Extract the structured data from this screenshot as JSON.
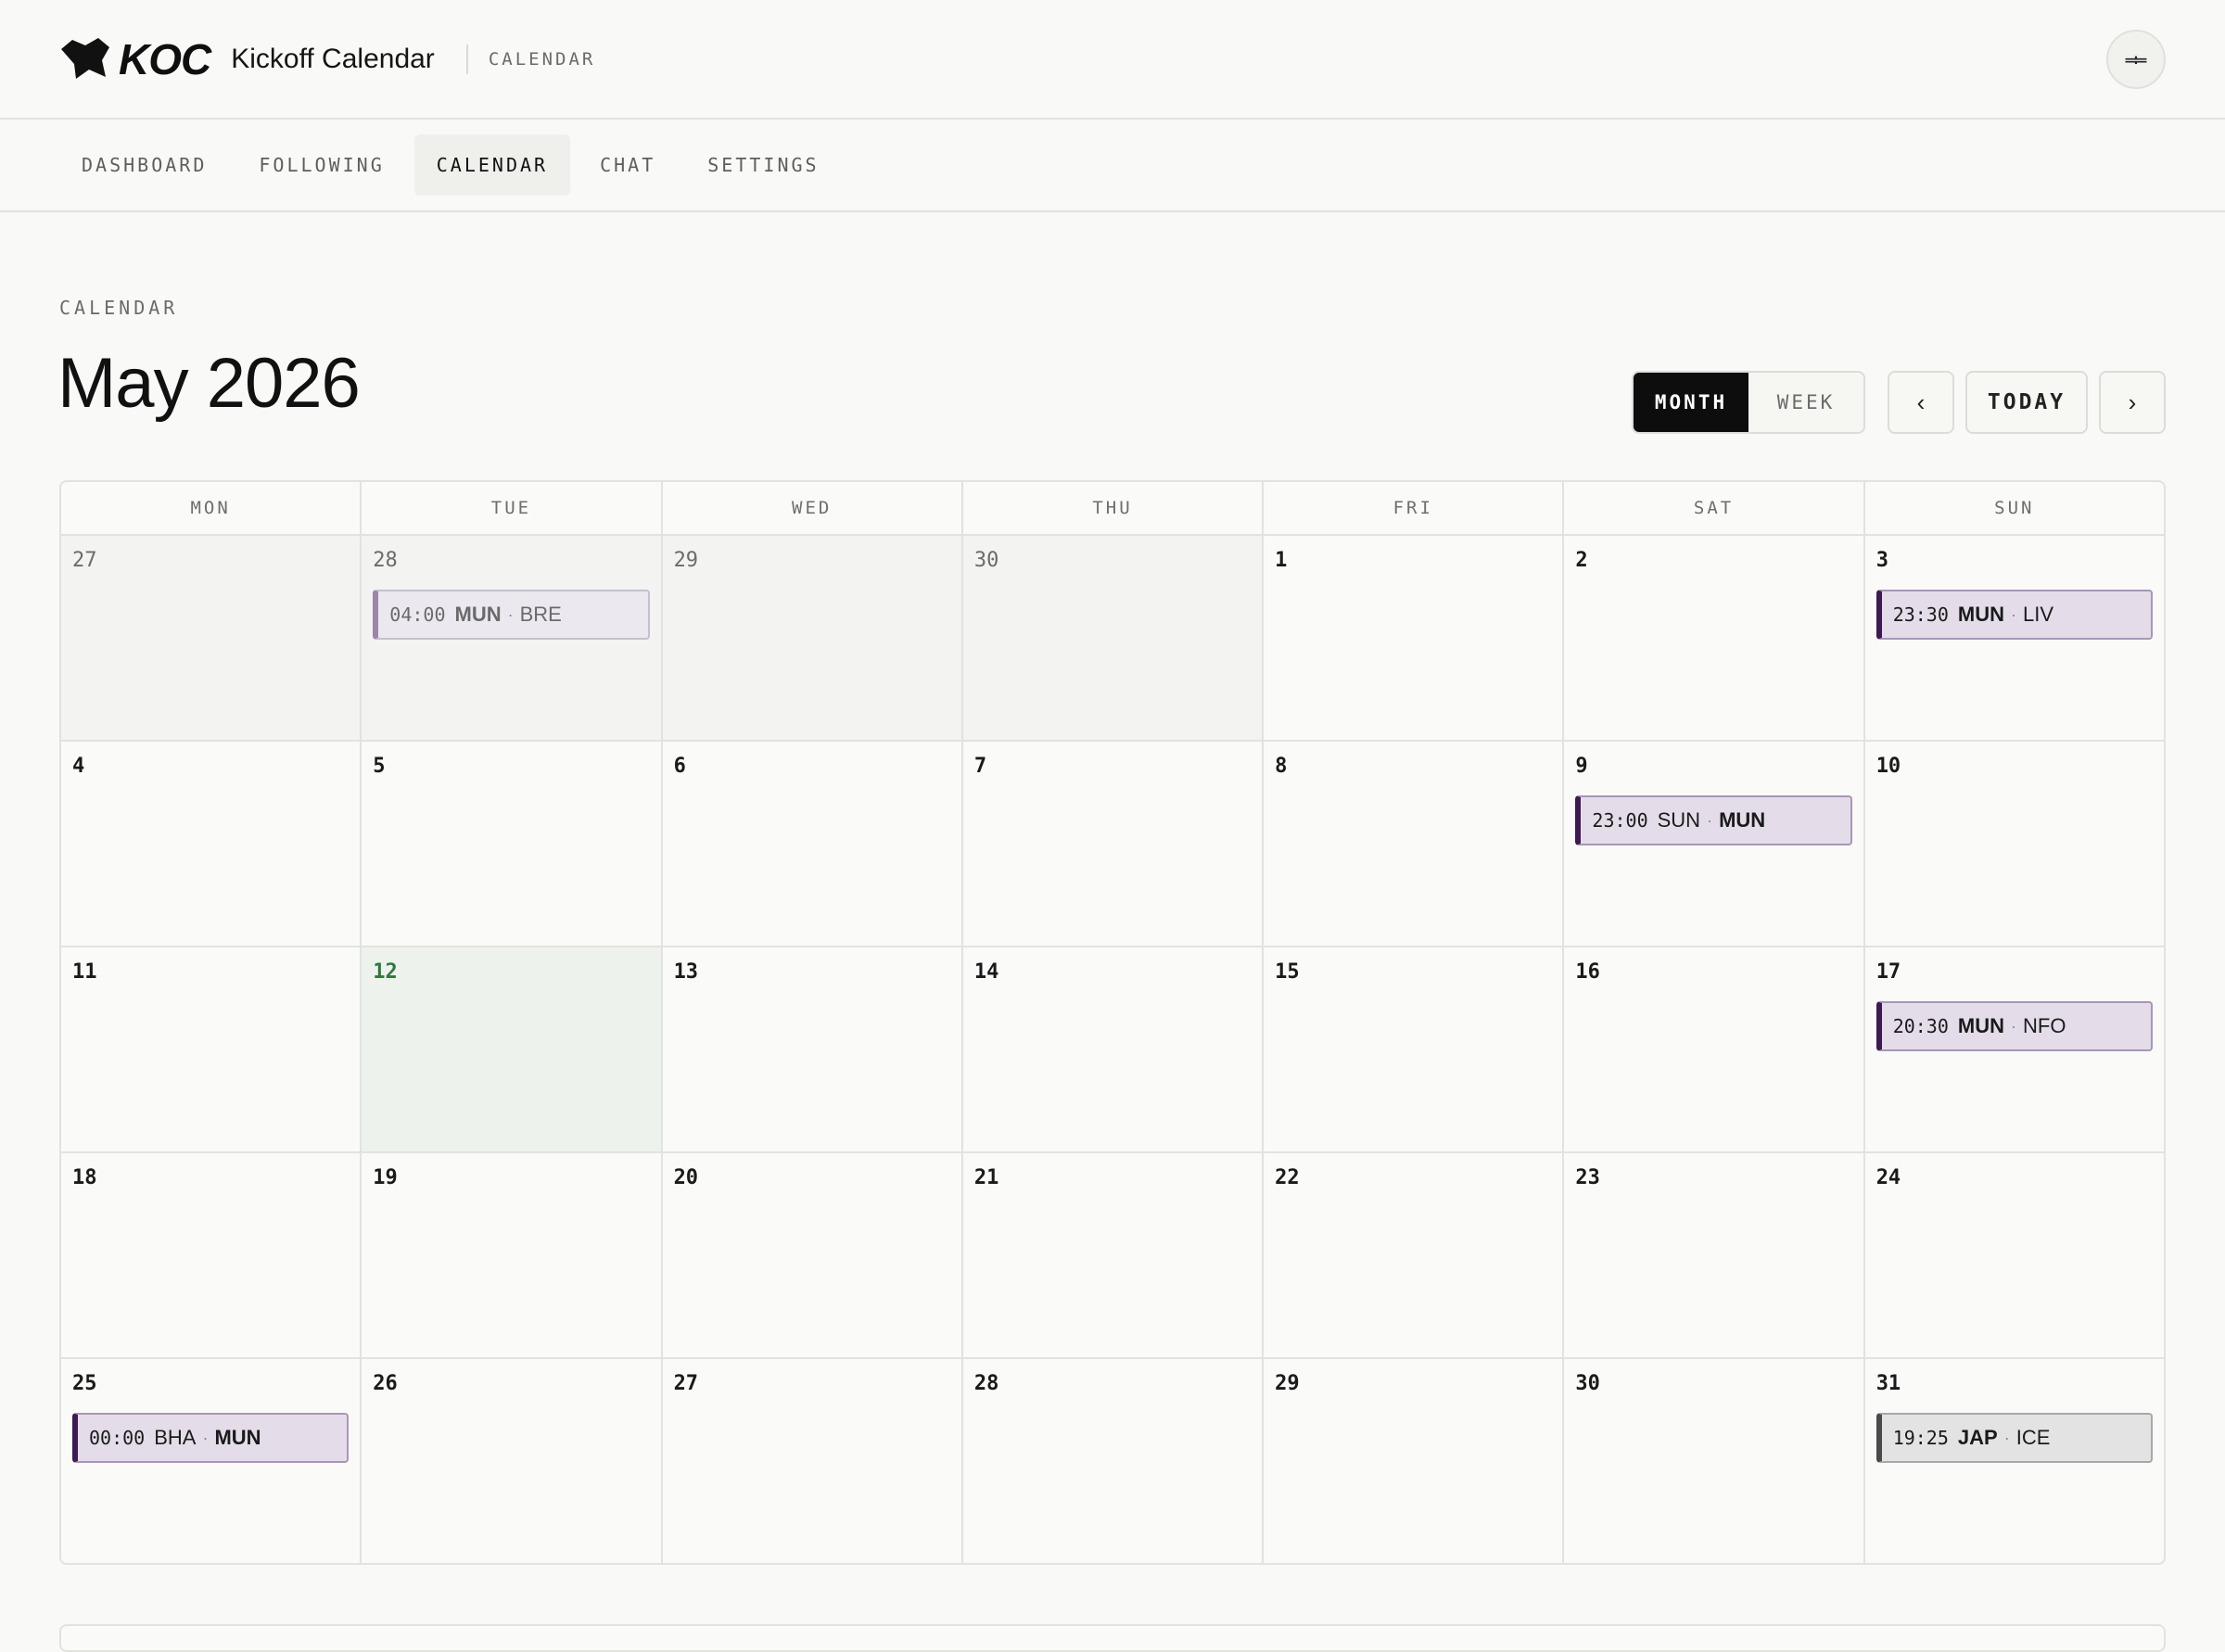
{
  "header": {
    "logo_text": "KOC",
    "app_title": "Kickoff Calendar",
    "section_tag": "CALENDAR",
    "avatar_glyph": "ᆃ"
  },
  "nav": {
    "items": [
      {
        "label": "DASHBOARD",
        "active": false
      },
      {
        "label": "FOLLOWING",
        "active": false
      },
      {
        "label": "CALENDAR",
        "active": true
      },
      {
        "label": "CHAT",
        "active": false
      },
      {
        "label": "SETTINGS",
        "active": false
      }
    ]
  },
  "page": {
    "eyebrow": "CALENDAR",
    "title": "May 2026"
  },
  "controls": {
    "month_label": "MONTH",
    "week_label": "WEEK",
    "active_view": "month",
    "prev_glyph": "‹",
    "today_label": "TODAY",
    "next_glyph": "›"
  },
  "calendar": {
    "weekdays": [
      "MON",
      "TUE",
      "WED",
      "THU",
      "FRI",
      "SAT",
      "SUN"
    ],
    "today": "12",
    "weeks": [
      [
        {
          "day": "27",
          "other": true
        },
        {
          "day": "28",
          "other": true,
          "event": {
            "time": "04:00",
            "home": "MUN",
            "away": "BRE",
            "strong": "home",
            "style": "faded"
          }
        },
        {
          "day": "29",
          "other": true
        },
        {
          "day": "30",
          "other": true
        },
        {
          "day": "1"
        },
        {
          "day": "2"
        },
        {
          "day": "3",
          "event": {
            "time": "23:30",
            "home": "MUN",
            "away": "LIV",
            "strong": "home",
            "style": "purple"
          }
        }
      ],
      [
        {
          "day": "4"
        },
        {
          "day": "5"
        },
        {
          "day": "6"
        },
        {
          "day": "7"
        },
        {
          "day": "8"
        },
        {
          "day": "9",
          "event": {
            "time": "23:00",
            "home": "SUN",
            "away": "MUN",
            "strong": "away",
            "style": "purple"
          }
        },
        {
          "day": "10"
        }
      ],
      [
        {
          "day": "11"
        },
        {
          "day": "12",
          "today": true
        },
        {
          "day": "13"
        },
        {
          "day": "14"
        },
        {
          "day": "15"
        },
        {
          "day": "16"
        },
        {
          "day": "17",
          "event": {
            "time": "20:30",
            "home": "MUN",
            "away": "NFO",
            "strong": "home",
            "style": "purple"
          }
        }
      ],
      [
        {
          "day": "18"
        },
        {
          "day": "19"
        },
        {
          "day": "20"
        },
        {
          "day": "21"
        },
        {
          "day": "22"
        },
        {
          "day": "23"
        },
        {
          "day": "24"
        }
      ],
      [
        {
          "day": "25",
          "event": {
            "time": "00:00",
            "home": "BHA",
            "away": "MUN",
            "strong": "away",
            "style": "purple"
          }
        },
        {
          "day": "26"
        },
        {
          "day": "27"
        },
        {
          "day": "28"
        },
        {
          "day": "29"
        },
        {
          "day": "30"
        },
        {
          "day": "31",
          "event": {
            "time": "19:25",
            "home": "JAP",
            "away": "ICE",
            "strong": "home",
            "style": "grey"
          }
        }
      ]
    ]
  },
  "colors": {
    "accent_purple": "#3d1a52",
    "today_green": "#2d7a3d",
    "active_toggle": "#0d0d0d"
  }
}
